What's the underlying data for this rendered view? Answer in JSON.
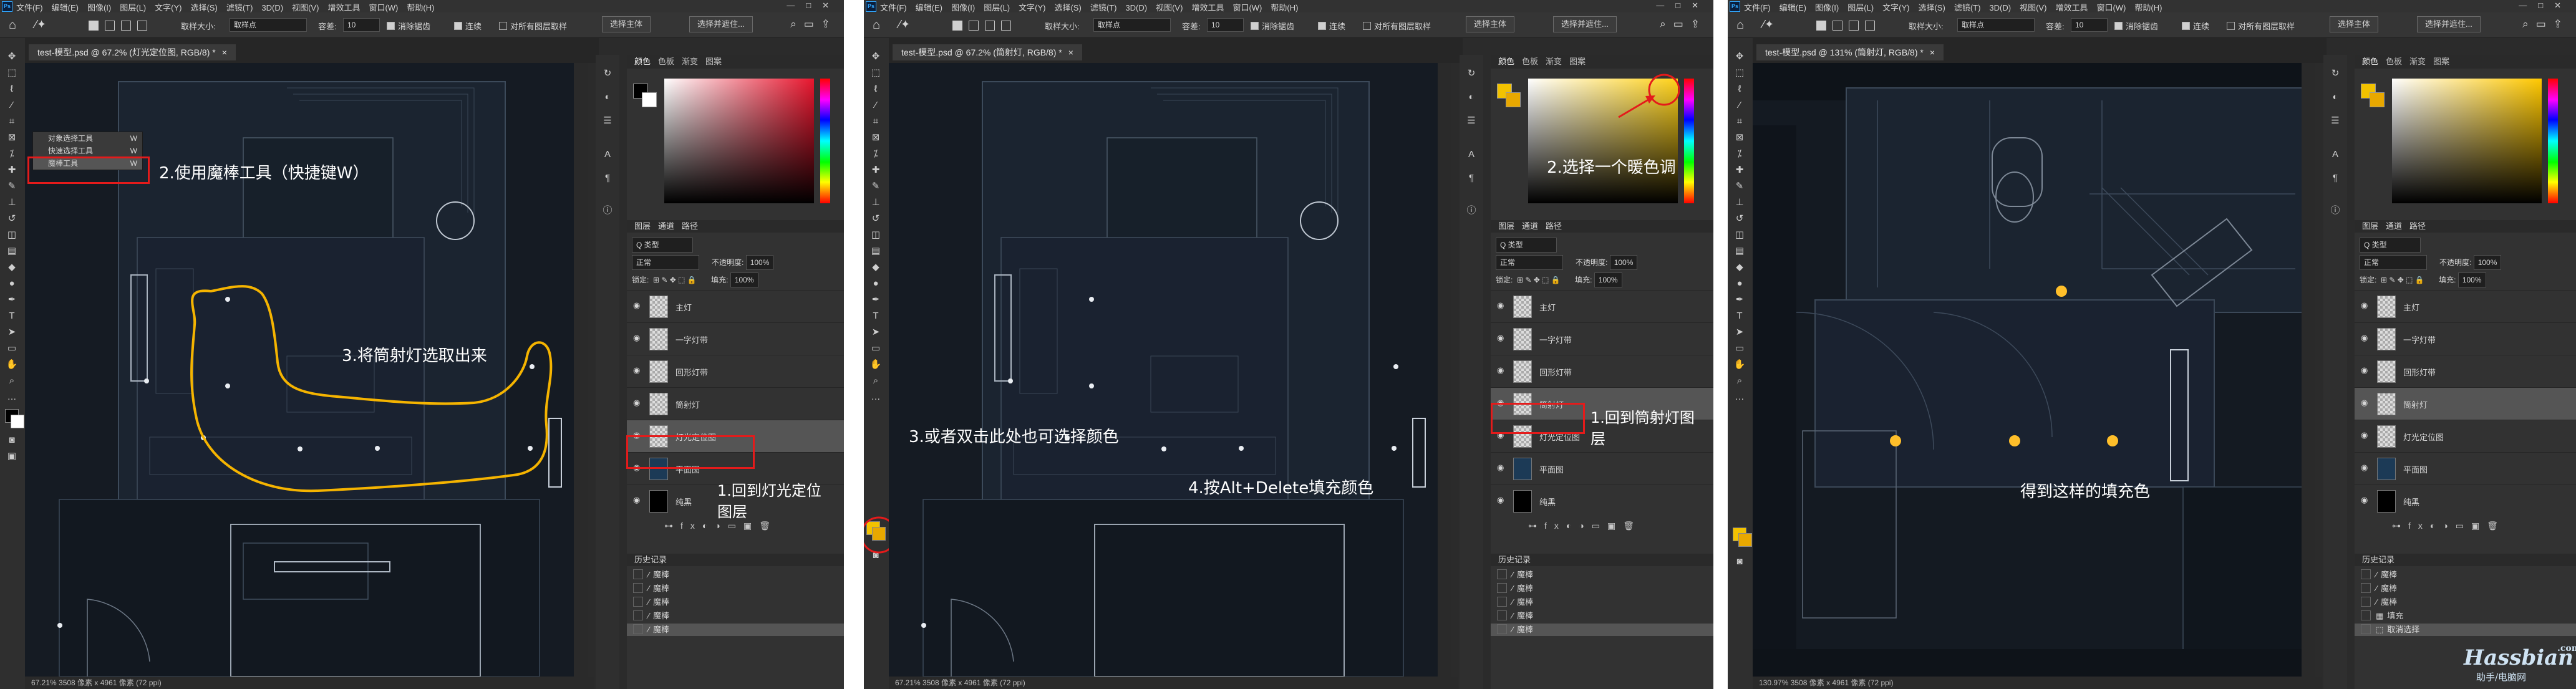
{
  "app": {
    "logo": "Ps",
    "menu": [
      "文件(F)",
      "编辑(E)",
      "图像(I)",
      "图层(L)",
      "文字(Y)",
      "选择(S)",
      "滤镜(T)",
      "3D(D)",
      "视图(V)",
      "增效工具",
      "窗口(W)",
      "帮助(H)"
    ],
    "window_controls": [
      "—",
      "□",
      "✕"
    ]
  },
  "options": {
    "sample_size_label": "取样大小:",
    "sample_size_value": "取样点",
    "tolerance_label": "容差:",
    "tolerance_value": "10",
    "antialias": "消除锯齿",
    "contiguous": "连续",
    "all_layers": "对所有图层取样",
    "select_subject": "选择主体",
    "select_mask": "选择并遮住..."
  },
  "panels": [
    {
      "tab": "test-模型.psd @ 67.2% (灯光定位图, RGB/8) *",
      "status": "67.21%    3508 像素 x 4961 像素 (72 ppi)",
      "selected_layer": 4,
      "history_selected": 3
    },
    {
      "tab": "test-模型.psd @ 67.2% (筒射灯, RGB/8) *",
      "status": "67.21%    3508 像素 x 4961 像素 (72 ppi)",
      "selected_layer": 3,
      "history_selected": 4
    },
    {
      "tab": "test-模型.psd @ 131% (筒射灯, RGB/8) *",
      "status": "130.97%    3508 像素 x 4961 像素 (72 ppi)",
      "selected_layer": 3,
      "history_selected": 5
    }
  ],
  "color_panel": {
    "tabs": [
      "颜色",
      "色板",
      "渐变",
      "图案"
    ]
  },
  "layers_panel": {
    "tabs": [
      "图层",
      "通道",
      "路径"
    ],
    "kind_label": "Q 类型",
    "blend_mode": "正常",
    "opacity_label": "不透明度:",
    "opacity_value": "100%",
    "lock_label": "锁定:",
    "fill_label": "填充:",
    "fill_value": "100%",
    "layers": [
      "主灯",
      "一字灯带",
      "回形灯带",
      "筒射灯",
      "灯光定位图",
      "平面图",
      "纯黑"
    ]
  },
  "history_panel": {
    "title": "历史记录",
    "items": [
      "魔棒",
      "魔棒",
      "魔棒",
      "魔棒",
      "魔棒"
    ],
    "items_p3": [
      "魔棒",
      "魔棒",
      "魔棒",
      "填充",
      "取消选择"
    ]
  },
  "flyout": {
    "items": [
      {
        "label": "对象选择工具",
        "key": "W"
      },
      {
        "label": "快速选择工具",
        "key": "W"
      },
      {
        "label": "魔棒工具",
        "key": "W"
      }
    ]
  },
  "annotations": {
    "p1_step2": "2.使用魔棒工具（快捷键W）",
    "p1_step3": "3.将筒射灯选取出来",
    "p1_step1": "1.回到灯光定位\n图层",
    "p2_step2": "2.选择一个暖色调",
    "p2_step1": "1.回到筒射灯图\n层",
    "p2_step3": "3.或者双击此处也可选择颜色",
    "p2_step4": "4.按Alt+Delete填充颜色",
    "p3_result": "得到这样的填充色"
  },
  "watermark": {
    "main": "Hassbian",
    "sub": "助手/电脑网",
    "com": ".com"
  },
  "colors": {
    "yellow_fill": "#ffbf2a",
    "annotation_red": "#e41b1b",
    "lasso_yellow": "#f5b400",
    "warm_fg": "#f2c200"
  }
}
